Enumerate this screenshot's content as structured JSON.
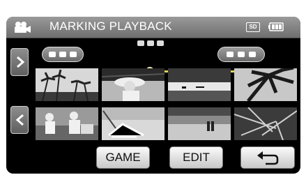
{
  "header": {
    "title": "MARKING PLAYBACK",
    "media_label": "SD",
    "camera_icon": "video-camera-icon",
    "battery_icon": "battery-icon"
  },
  "controls": {
    "next_page_icon": "chevron-right-icon",
    "prev_page_icon": "chevron-left-icon",
    "game_label": "GAME",
    "edit_label": "EDIT",
    "back_icon": "return-arrow-icon"
  },
  "timeline": {
    "left_marker": "marker-pill",
    "right_marker": "marker-pill",
    "position_fraction": 0.3
  },
  "thumbnails": [
    {
      "scene": "palm-trees-beach"
    },
    {
      "scene": "woman-hat-swing"
    },
    {
      "scene": "lake-silhouette"
    },
    {
      "scene": "palm-leaves"
    },
    {
      "scene": "soccer-players"
    },
    {
      "scene": "beach-chair"
    },
    {
      "scene": "couple-beach"
    },
    {
      "scene": "tropical-fronds"
    }
  ]
}
